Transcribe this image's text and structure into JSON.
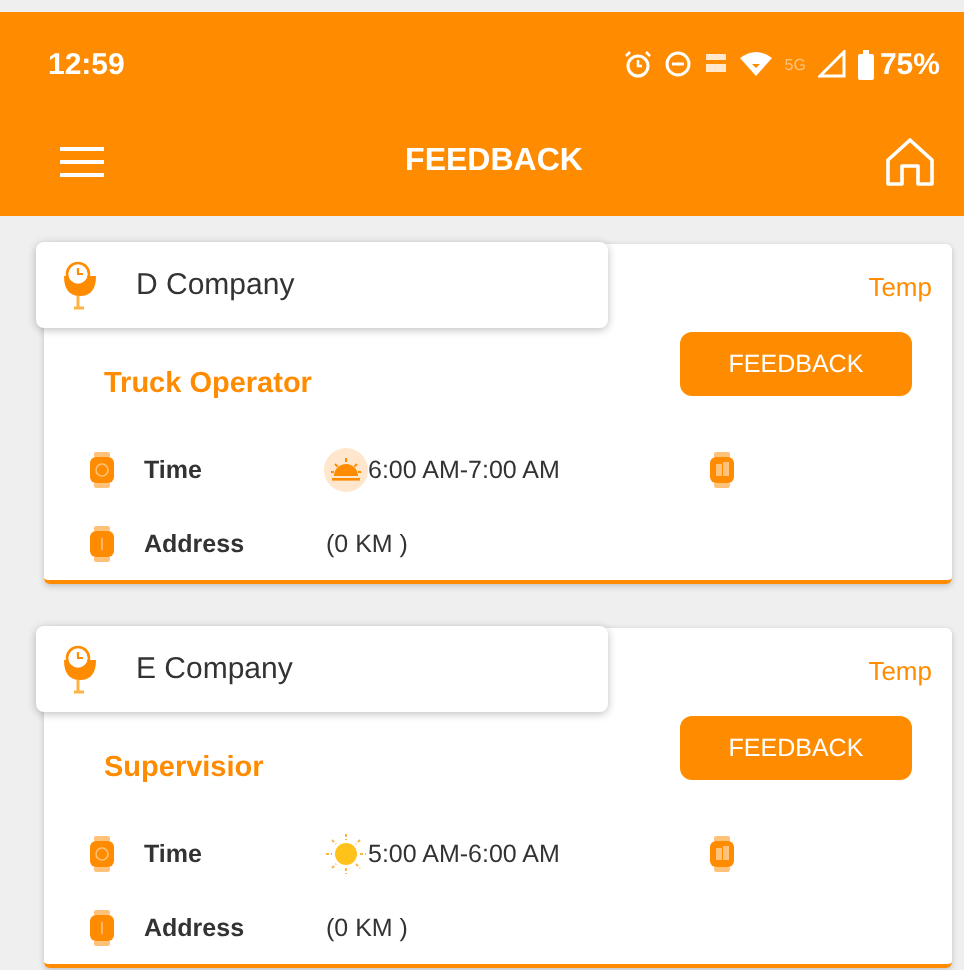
{
  "status_bar": {
    "time": "12:59",
    "network": "5G",
    "battery": "75%"
  },
  "header": {
    "title": "FEEDBACK"
  },
  "jobs": [
    {
      "company": "D Company",
      "type": "Temp",
      "role": "Truck Operator",
      "button": "FEEDBACK",
      "time_label": "Time",
      "kind": "sunrise",
      "time": "6:00 AM-7:00 AM",
      "address_label": "Address",
      "distance": "(0 KM )"
    },
    {
      "company": "E Company",
      "type": "Temp",
      "role": "Supervisior",
      "button": "FEEDBACK",
      "time_label": "Time",
      "kind": "sun",
      "time": "5:00 AM-6:00 AM",
      "address_label": "Address",
      "distance": "(0 KM )"
    }
  ]
}
